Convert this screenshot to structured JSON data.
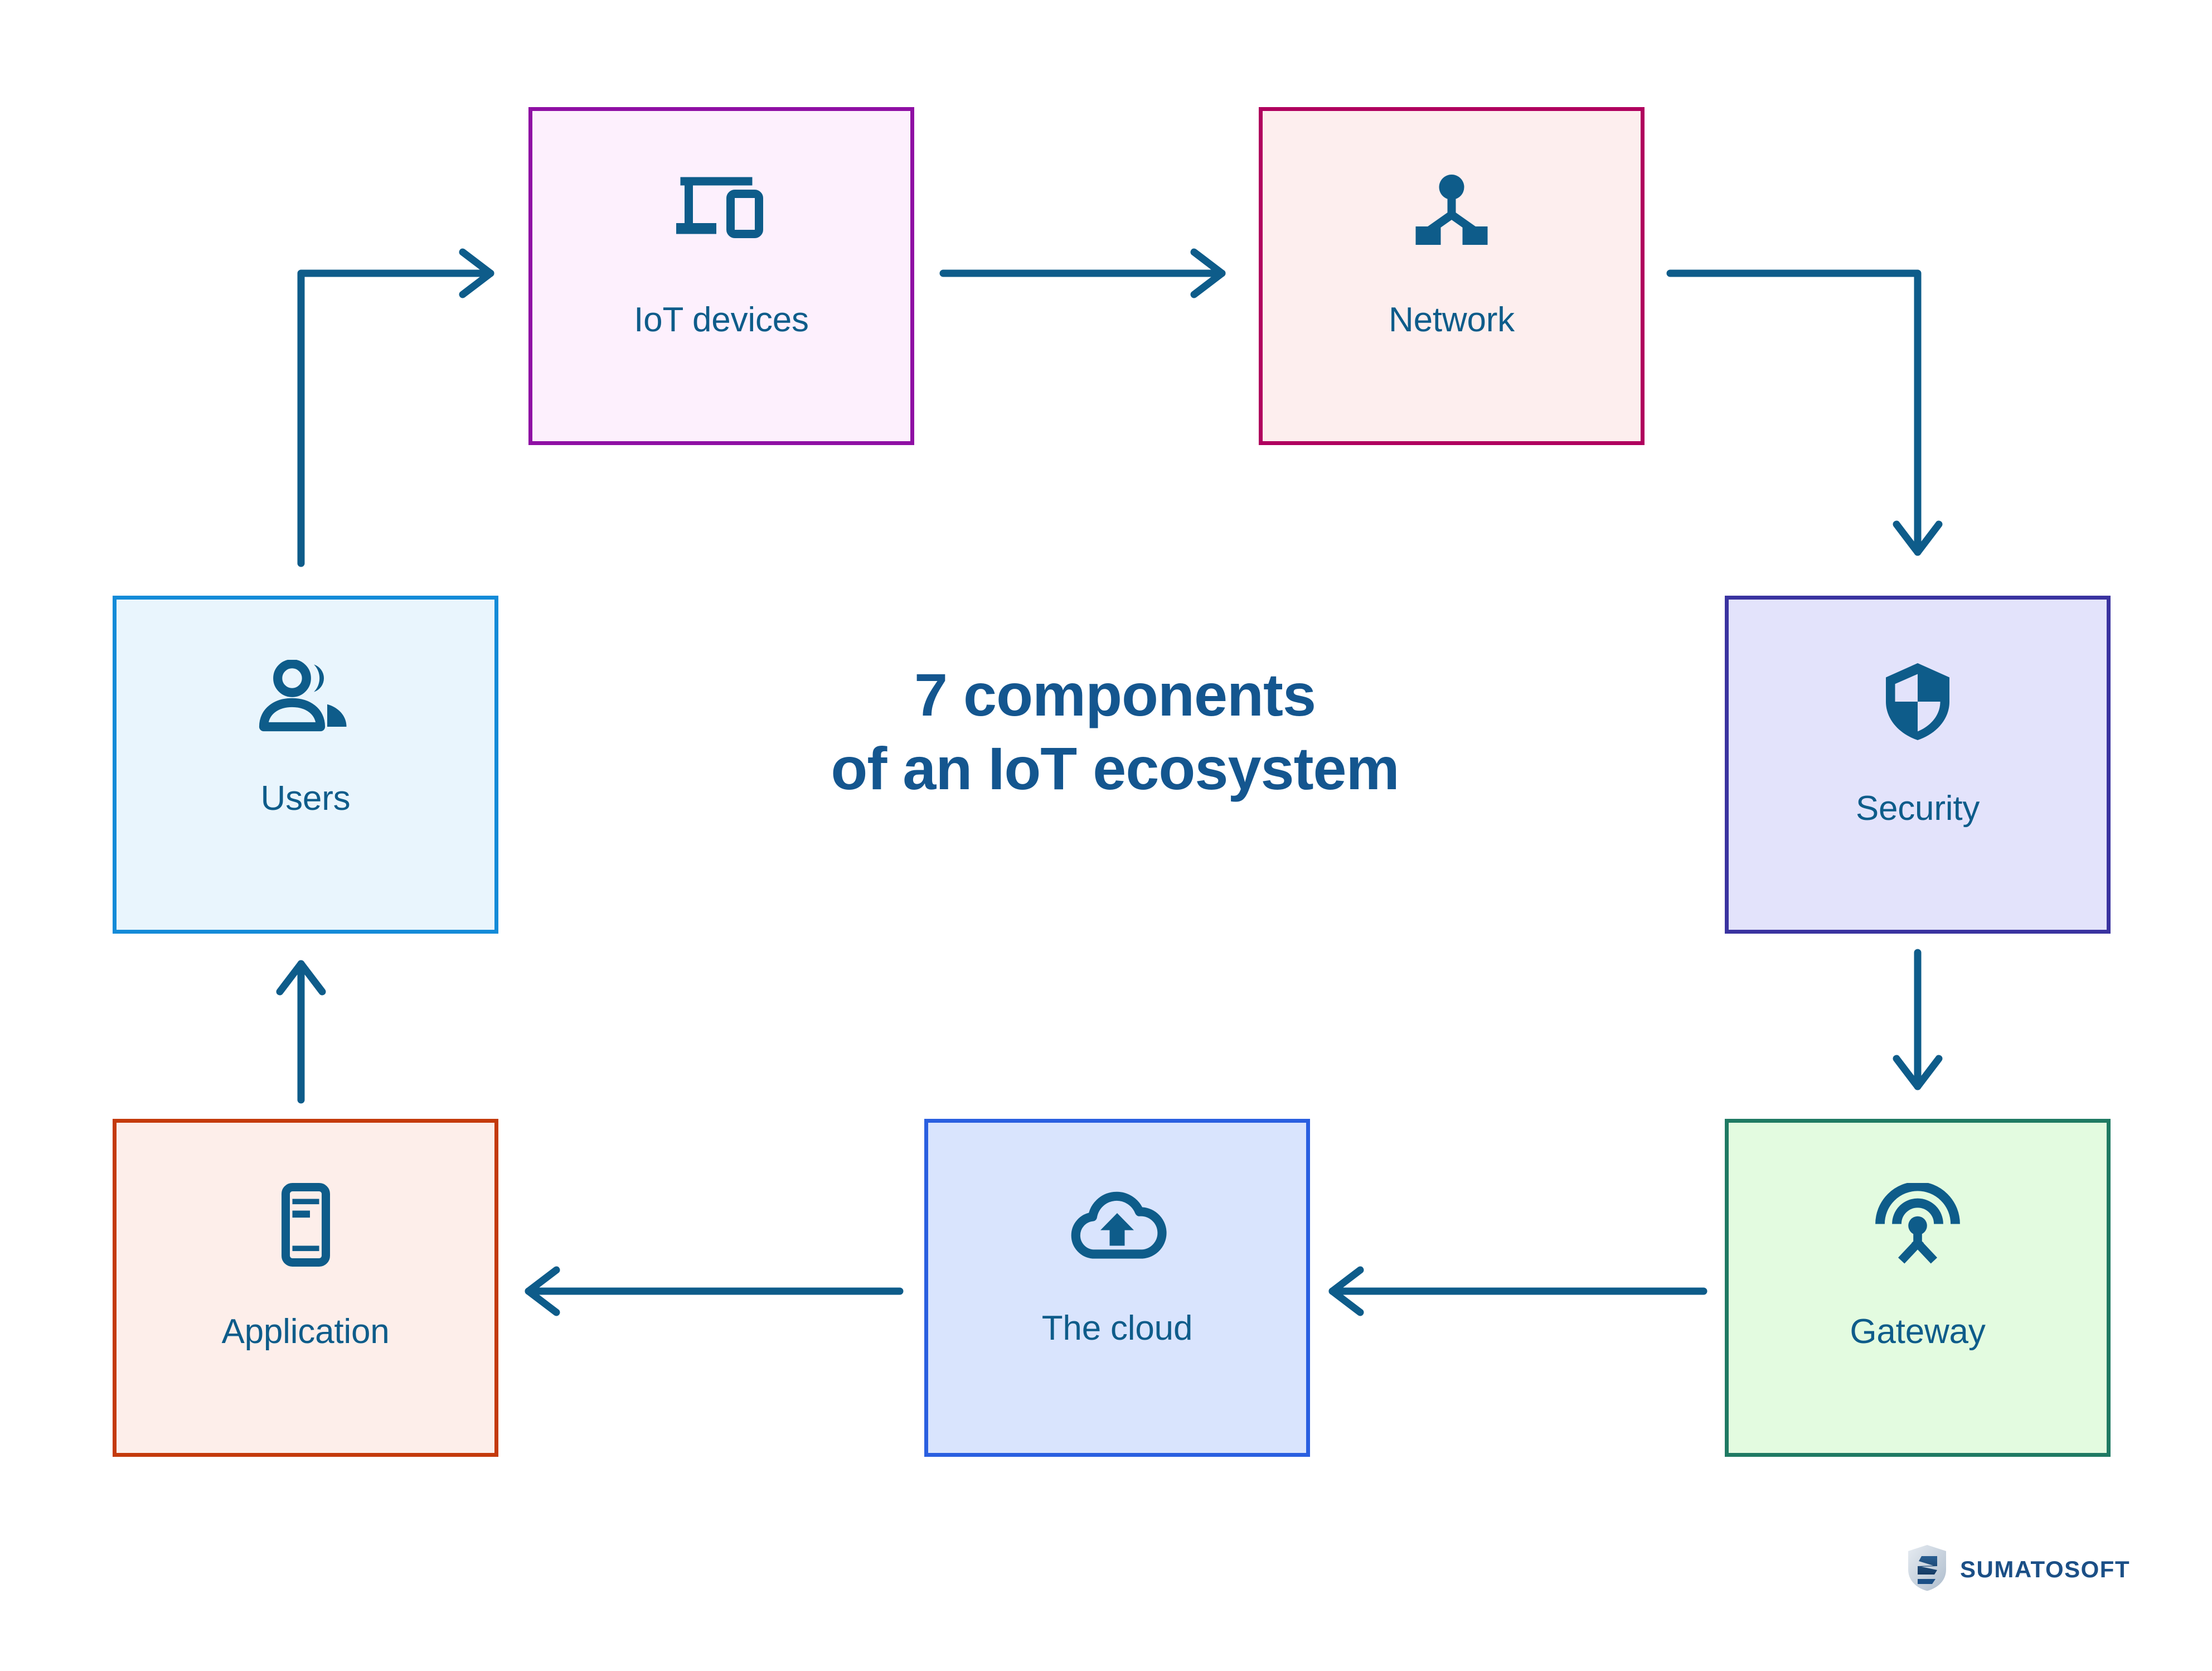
{
  "title": {
    "line1": "7 components",
    "line2": "of an IoT ecosystem",
    "color": "#14568f"
  },
  "nodes": [
    {
      "id": "iot-devices",
      "label": "IoT devices",
      "icon": "devices-icon",
      "fill": "#fdf0fd",
      "border": "#8f10a4",
      "shadow": "#8f10a4",
      "icon_color": "#0e5c8a"
    },
    {
      "id": "network",
      "label": "Network",
      "icon": "network-hierarchy-icon",
      "fill": "#fdeeee",
      "border": "#b0005e",
      "shadow": "#b0005e",
      "icon_color": "#0e5c8a"
    },
    {
      "id": "security",
      "label": "Security",
      "icon": "shield-icon",
      "fill": "#e3e3fb",
      "border": "#3a33a0",
      "shadow": "#3a33a0",
      "icon_color": "#0e5c8a"
    },
    {
      "id": "gateway",
      "label": "Gateway",
      "icon": "antenna-broadcast-icon",
      "fill": "#e3fbe0",
      "border": "#1f7a63",
      "shadow": "#1f7a63",
      "icon_color": "#0e5c8a"
    },
    {
      "id": "the-cloud",
      "label": "The cloud",
      "icon": "cloud-upload-icon",
      "fill": "#d9e4fd",
      "border": "#2a5fe0",
      "shadow": "#2a5fe0",
      "icon_color": "#0e5c8a"
    },
    {
      "id": "application",
      "label": "Application",
      "icon": "smartphone-icon",
      "fill": "#fdeeea",
      "border": "#c43a0c",
      "shadow": "#c43a0c",
      "icon_color": "#0e5c8a"
    },
    {
      "id": "users",
      "label": "Users",
      "icon": "users-group-icon",
      "fill": "#e9f5fd",
      "border": "#148bd8",
      "shadow": "#148bd8",
      "icon_color": "#0e5c8a"
    }
  ],
  "connectors": [
    {
      "id": "users-to-iot-devices",
      "from": "users",
      "to": "iot-devices",
      "shape": "up-then-right"
    },
    {
      "id": "iot-devices-to-network",
      "from": "iot-devices",
      "to": "network",
      "shape": "right"
    },
    {
      "id": "network-to-security",
      "from": "network",
      "to": "security",
      "shape": "right-then-down"
    },
    {
      "id": "security-to-gateway",
      "from": "security",
      "to": "gateway",
      "shape": "down"
    },
    {
      "id": "gateway-to-the-cloud",
      "from": "gateway",
      "to": "the-cloud",
      "shape": "left"
    },
    {
      "id": "the-cloud-to-application",
      "from": "the-cloud",
      "to": "application",
      "shape": "left"
    },
    {
      "id": "application-to-users",
      "from": "application",
      "to": "users",
      "shape": "up"
    }
  ],
  "connector_color": "#0e5c8a",
  "logo": {
    "wordmark": "SUMATOSOFT",
    "mark": "sumatosoft-shield-icon",
    "color": "#1b4f86"
  },
  "background": "#ffffff"
}
